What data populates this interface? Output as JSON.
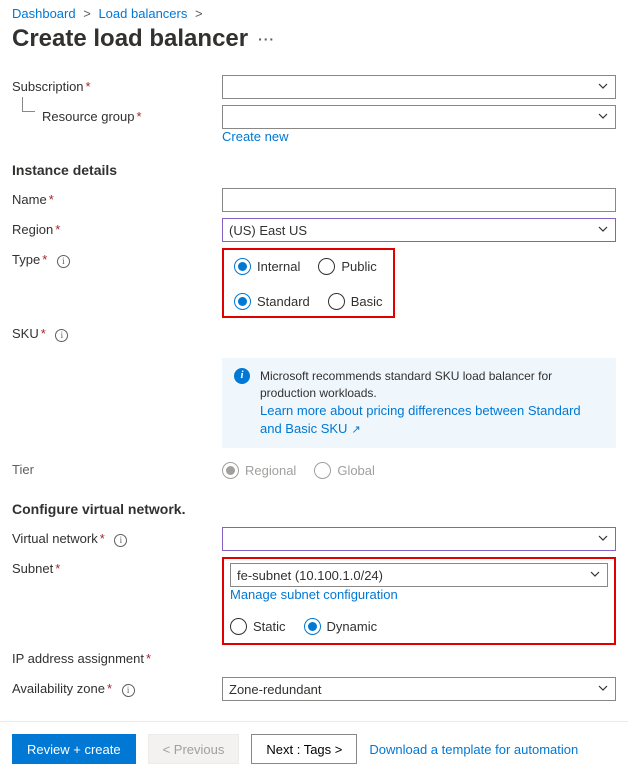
{
  "breadcrumb": {
    "items": [
      "Dashboard",
      "Load balancers"
    ],
    "sep": ">"
  },
  "title": "Create load balancer",
  "labels": {
    "subscription": "Subscription",
    "resourceGroup": "Resource group",
    "createNew": "Create new",
    "instanceDetails": "Instance details",
    "name": "Name",
    "region": "Region",
    "type": "Type",
    "sku": "SKU",
    "tier": "Tier",
    "configureVnet": "Configure virtual network.",
    "vnet": "Virtual network",
    "subnet": "Subnet",
    "manageSubnet": "Manage subnet configuration",
    "ipAssign": "IP address assignment",
    "availZone": "Availability zone"
  },
  "values": {
    "subscription": "",
    "resourceGroup": "",
    "name": "",
    "region": "(US) East US",
    "vnet": "",
    "subnet": "fe-subnet (10.100.1.0/24)",
    "availZone": "Zone-redundant"
  },
  "radios": {
    "type": {
      "options": [
        "Internal",
        "Public"
      ],
      "selected": "Internal"
    },
    "sku": {
      "options": [
        "Standard",
        "Basic"
      ],
      "selected": "Standard"
    },
    "tier": {
      "options": [
        "Regional",
        "Global"
      ],
      "selected": "Regional",
      "disabled": true
    },
    "ipAssign": {
      "options": [
        "Static",
        "Dynamic"
      ],
      "selected": "Dynamic"
    }
  },
  "infobox": {
    "text": "Microsoft recommends standard SKU load balancer for production workloads.",
    "link": "Learn more about pricing differences between Standard and Basic SKU"
  },
  "footer": {
    "review": "Review + create",
    "previous": "< Previous",
    "next": "Next : Tags >",
    "download": "Download a template for automation"
  }
}
